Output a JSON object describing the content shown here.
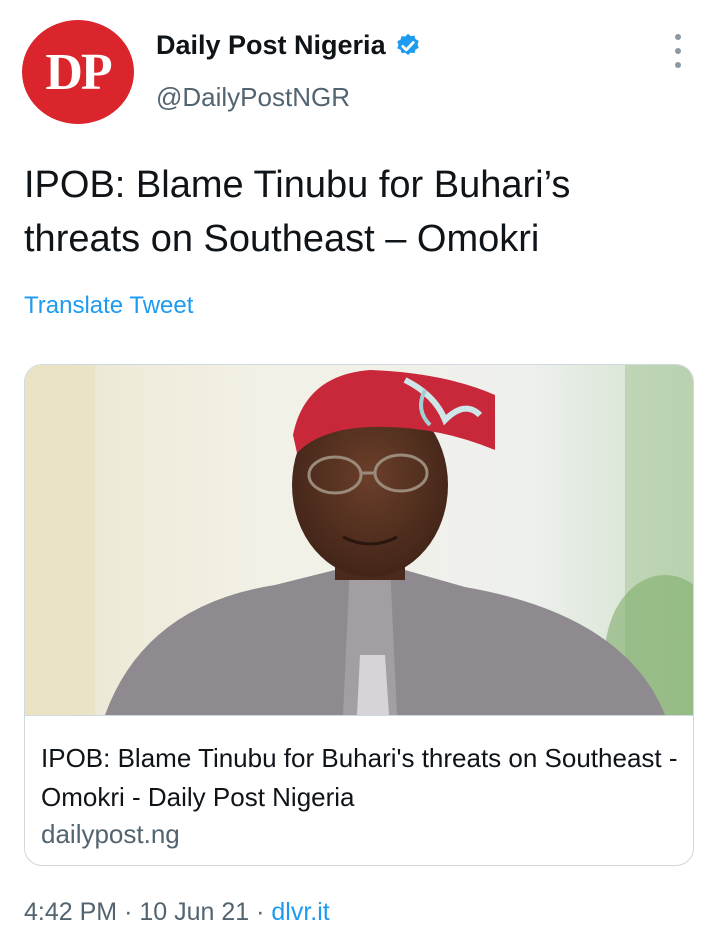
{
  "author": {
    "avatar_text": "DP",
    "name": "Daily Post Nigeria",
    "handle": "@DailyPostNGR",
    "verified": true
  },
  "tweet": {
    "text": "IPOB: Blame Tinubu for Buhari’s threats on Southeast – Omokri",
    "translate_label": "Translate Tweet"
  },
  "card": {
    "title": "IPOB: Blame Tinubu for Buhari's threats on Southeast - Omokri - Daily Post Nigeria",
    "domain": "dailypost.ng"
  },
  "meta": {
    "time": "4:42 PM",
    "separator": "·",
    "date": "10 Jun 21",
    "source": "dlvr.it"
  },
  "colors": {
    "avatar_bg": "#d9252b",
    "link": "#1d9bf0",
    "secondary_text": "#536471"
  },
  "icons": [
    "verified-badge-icon",
    "more-options-icon"
  ]
}
